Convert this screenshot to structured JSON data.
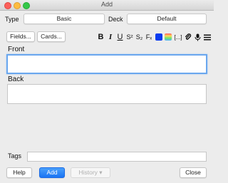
{
  "window": {
    "title": "Add"
  },
  "type_row": {
    "type_label": "Type",
    "type_value": "Basic",
    "deck_label": "Deck",
    "deck_value": "Default"
  },
  "buttons": {
    "fields": "Fields...",
    "cards": "Cards..."
  },
  "toolbar": {
    "bold": "B",
    "italic": "I",
    "underline": "U",
    "superscript": "S²",
    "subscript": "S₂",
    "clear_format": "Fₓ",
    "text_color": "#0a3cf0",
    "cloze": "[...]"
  },
  "fields": [
    {
      "label": "Front",
      "value": ""
    },
    {
      "label": "Back",
      "value": ""
    }
  ],
  "tags": {
    "label": "Tags",
    "value": ""
  },
  "bottom": {
    "help": "Help",
    "add": "Add",
    "history": "History ▾",
    "close": "Close"
  }
}
